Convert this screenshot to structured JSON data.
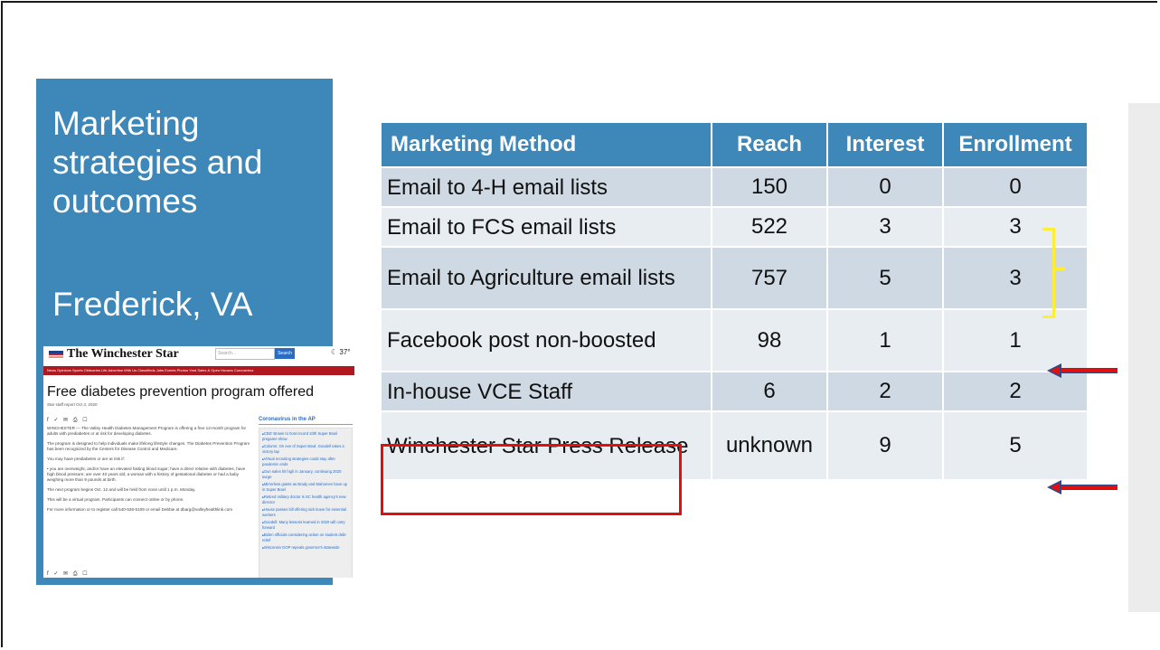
{
  "panel": {
    "title": "Marketing strategies and outcomes",
    "subtitle": "Frederick, VA"
  },
  "article": {
    "logo": "The Winchester Star",
    "search_placeholder": "Search...",
    "search_button": "Search",
    "temperature": "37°",
    "nav": "News  Opinions  Sports  Obituaries  Life  Advertise With Us  Classifieds  Jobs  Events  Photos  Yard Sales & Open Houses  Coronavirus",
    "headline": "Free diabetes prevention program offered",
    "byline": "Star staff report   Oct 3, 2020",
    "paragraphs": [
      "WINCHESTER — The Valley Health Diabetes Management Program is offering a free 12-month program for adults with prediabetes or at risk for developing diabetes.",
      "The program is designed to help individuals make lifelong lifestyle changes. The Diabetes Prevention Program has been recognized by the Centers for Disease Control and Medicare.",
      "You may have prediabetes or are at risk if:",
      "• you are overweight, and/or have an elevated fasting blood sugar; have a direct relative with diabetes, have high blood pressure; are over 40 years old; a woman with a history of gestational diabetes or had a baby weighing more than 9 pounds at birth.",
      "The next program begins Oct. 12 and will be held from noon until 1 p.m. Monday.",
      "This will be a virtual program. Participants can connect online or by phone.",
      "For more information or to register call 540-536-5109 or email Debbie at dbarg@valleyhealthlink.com"
    ],
    "sidebar_title": "Coronavirus in the AP",
    "sidebar_items": [
      "CBS' Brown to host record 10th Super Bowl pregame show",
      "Column: On eve of Super Bowl, Goodell takes a victory lap",
      "Virtual recruiting strategies could stay after pandemic ends",
      "Gun sales hit high in January, continuing 2020 surge",
      "Mirrorless giants as Brady and Mahomes have up in Super Bowl",
      "Retired military doctor is SC health agency's new director",
      "House passes bill offering sick leave for essential workers",
      "Goodell: Many lessons learned in 2020 will carry forward",
      "Biden officials considering action on student debt relief",
      "Wisconsin GOP repeals governor's statewide"
    ]
  },
  "table": {
    "headers": [
      "Marketing Method",
      "Reach",
      "Interest",
      "Enrollment"
    ],
    "rows": [
      {
        "method": "Email to 4-H email lists",
        "reach": "150",
        "interest": "0",
        "enrollment": "0"
      },
      {
        "method": "Email to FCS email lists",
        "reach": "522",
        "interest": "3",
        "enrollment": "3"
      },
      {
        "method": "Email to Agriculture email lists",
        "reach": "757",
        "interest": "5",
        "enrollment": "3"
      },
      {
        "method": "Facebook post non-boosted",
        "reach": "98",
        "interest": "1",
        "enrollment": "1"
      },
      {
        "method": "In-house VCE Staff",
        "reach": "6",
        "interest": "2",
        "enrollment": "2"
      },
      {
        "method": "Winchester Star Press Release",
        "reach": "unknown",
        "interest": "9",
        "enrollment": "5"
      }
    ]
  },
  "colors": {
    "accent_blue": "#3d87b9",
    "row_dark": "#cfd9e3",
    "row_light": "#e8edf2",
    "highlight_red": "#e01010",
    "bracket_yellow": "#ffee33"
  }
}
